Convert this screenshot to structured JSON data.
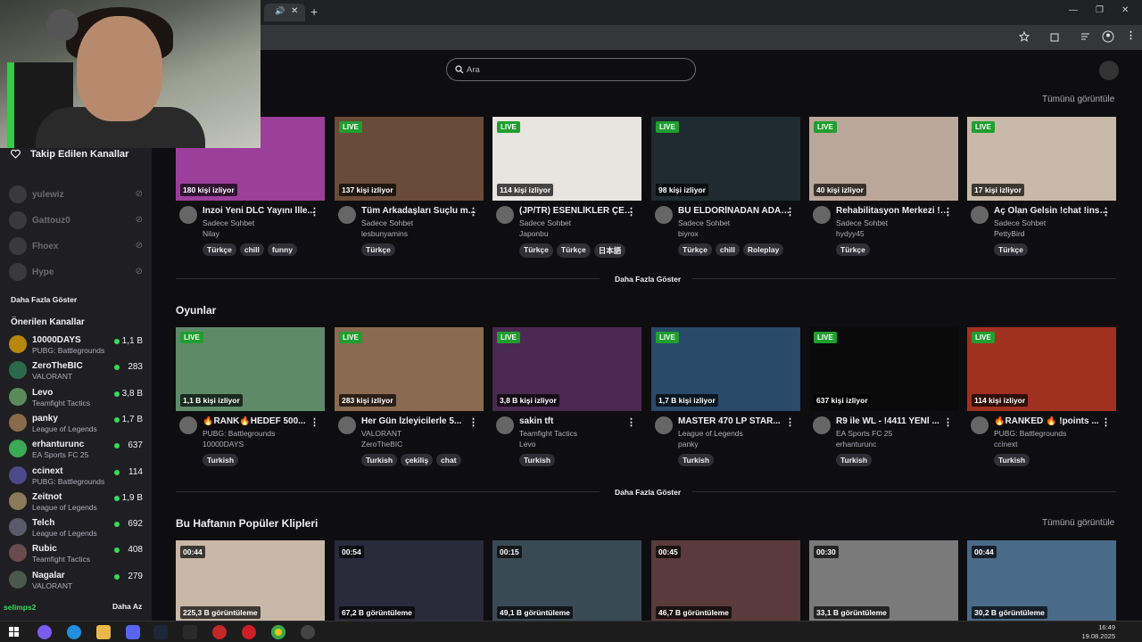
{
  "browser": {
    "tab_mute": "🔊",
    "tab_close": "✕",
    "new_tab": "+",
    "minimize": "—",
    "restore": "❐",
    "close": "✕"
  },
  "search": {
    "placeholder": "Ara"
  },
  "sidebar": {
    "followed_title": "Takip Edilen Kanallar",
    "offline": [
      {
        "name": "yulewiz"
      },
      {
        "name": "Gattouz0"
      },
      {
        "name": "Fhoex"
      },
      {
        "name": "Hype"
      }
    ],
    "show_more": "Daha Fazla Göster",
    "recommended_title": "Önerilen Kanallar",
    "recommended": [
      {
        "name": "10000DAYS",
        "game": "PUBG: Battlegrounds",
        "viewers": "1,1 B"
      },
      {
        "name": "ZeroTheBIC",
        "game": "VALORANT",
        "viewers": "283"
      },
      {
        "name": "Levo",
        "game": "Teamfight Tactics",
        "viewers": "3,8 B"
      },
      {
        "name": "panky",
        "game": "League of Legends",
        "viewers": "1,7 B"
      },
      {
        "name": "erhanturunc",
        "game": "EA Sports FC 25",
        "viewers": "637"
      },
      {
        "name": "ccinext",
        "game": "PUBG: Battlegrounds",
        "viewers": "114"
      },
      {
        "name": "Zeitnot",
        "game": "League of Legends",
        "viewers": "1,9 B"
      },
      {
        "name": "Telch",
        "game": "League of Legends",
        "viewers": "692"
      },
      {
        "name": "Rubic",
        "game": "Teamfight Tactics",
        "viewers": "408"
      },
      {
        "name": "Nagalar",
        "game": "VALORANT",
        "viewers": "279"
      }
    ],
    "show_less": "Daha Az",
    "bottom_user": "selimps2"
  },
  "main": {
    "view_all": "Tümünü görüntüle",
    "show_more": "Daha Fazla Göster",
    "row1": [
      {
        "viewers": "180 kişi izliyor",
        "title": "Inzoi Yeni DLC Yayını İlle...",
        "category": "Sadece Sohbet",
        "user": "Nilay",
        "tags": [
          "Türkçe",
          "chill",
          "funny"
        ],
        "live": "",
        "color": "#9b3f9a"
      },
      {
        "viewers": "137 kişi izliyor",
        "title": "Tüm Arkadaşları Suçlu m...",
        "category": "Sadece Sohbet",
        "user": "lesbunyamins",
        "tags": [
          "Türkçe"
        ],
        "live": "LIVE",
        "color": "#6a4a38"
      },
      {
        "viewers": "114 kişi izliyor",
        "title": "(JP/TR) ESENLİKLER ÇET ...",
        "category": "Sadece Sohbet",
        "user": "Japonbu",
        "tags": [
          "Türkçe",
          "Türkçe",
          "日本語"
        ],
        "live": "LIVE",
        "color": "#e8e4df"
      },
      {
        "viewers": "98 kişi izliyor",
        "title": "BU ELDORİNADAN ADAM ...",
        "category": "Sadece Sohbet",
        "user": "biyrox",
        "tags": [
          "Türkçe",
          "chill",
          "Roleplay"
        ],
        "live": "LIVE",
        "color": "#1f2b30"
      },
      {
        "viewers": "40 kişi izliyor",
        "title": "Rehabilitasyon Merkezi !B...",
        "category": "Sadece Sohbet",
        "user": "hydyy45",
        "tags": [
          "Türkçe"
        ],
        "live": "LIVE",
        "color": "#bba79a"
      },
      {
        "viewers": "17 kişi izliyor",
        "title": "Aç Olan Gelsin !chat !inst...",
        "category": "Sadece Sohbet",
        "user": "PettyBird",
        "tags": [
          "Türkçe"
        ],
        "live": "LIVE",
        "color": "#c9b9a8"
      }
    ],
    "games_title": "Oyunlar",
    "row2": [
      {
        "viewers": "1,1 B kişi izliyor",
        "title": "🔥RANK🔥HEDEF 500...",
        "category": "PUBG: Battlegrounds",
        "user": "10000DAYS",
        "tags": [
          "Turkish"
        ],
        "live": "LIVE",
        "color": "#5f8a6a"
      },
      {
        "viewers": "283 kişi izliyor",
        "title": "Her Gün İzleyicilerle 5...",
        "category": "VALORANT",
        "user": "ZeroTheBIC",
        "tags": [
          "Turkish",
          "çekiliş",
          "chat"
        ],
        "live": "LIVE",
        "color": "#8a6a50"
      },
      {
        "viewers": "3,8 B kişi izliyor",
        "title": "sakin tft",
        "category": "Teamfight Tactics",
        "user": "Levo",
        "tags": [
          "Turkish"
        ],
        "live": "LIVE",
        "color": "#4a2a50"
      },
      {
        "viewers": "1,7 B kişi izliyor",
        "title": "MASTER 470 LP STAR...",
        "category": "League of Legends",
        "user": "panky",
        "tags": [
          "Turkish"
        ],
        "live": "LIVE",
        "color": "#2a4a6a"
      },
      {
        "viewers": "637 kişi izliyor",
        "title": "R9 ile WL - !4411 YENİ ...",
        "category": "EA Sports FC 25",
        "user": "erhanturunc",
        "tags": [
          "Turkish"
        ],
        "live": "LIVE",
        "color": "#0a0a0a"
      },
      {
        "viewers": "114 kişi izliyor",
        "title": "🔥RANKED 🔥 !points ...",
        "category": "PUBG: Battlegrounds",
        "user": "ccinext",
        "tags": [
          "Turkish"
        ],
        "live": "LIVE",
        "color": "#a03020"
      }
    ],
    "clips_title": "Bu Haftanın Popüler Klipleri",
    "clips": [
      {
        "duration": "00:44",
        "views": "225,3 B görüntüleme",
        "color": "#c8b8a8"
      },
      {
        "duration": "00:54",
        "views": "67,2 B görüntüleme",
        "color": "#2a2a3a"
      },
      {
        "duration": "00:15",
        "views": "49,1 B görüntüleme",
        "color": "#3a4a55"
      },
      {
        "duration": "00:45",
        "views": "46,7 B görüntüleme",
        "color": "#5a3a3a"
      },
      {
        "duration": "00:30",
        "views": "33,1 B görüntüleme",
        "color": "#7a7a7a"
      },
      {
        "duration": "00:44",
        "views": "30,2 B görüntüleme",
        "color": "#4a6a8a"
      }
    ]
  },
  "taskbar": {
    "time": "16:49",
    "date": "19.08.2025"
  }
}
